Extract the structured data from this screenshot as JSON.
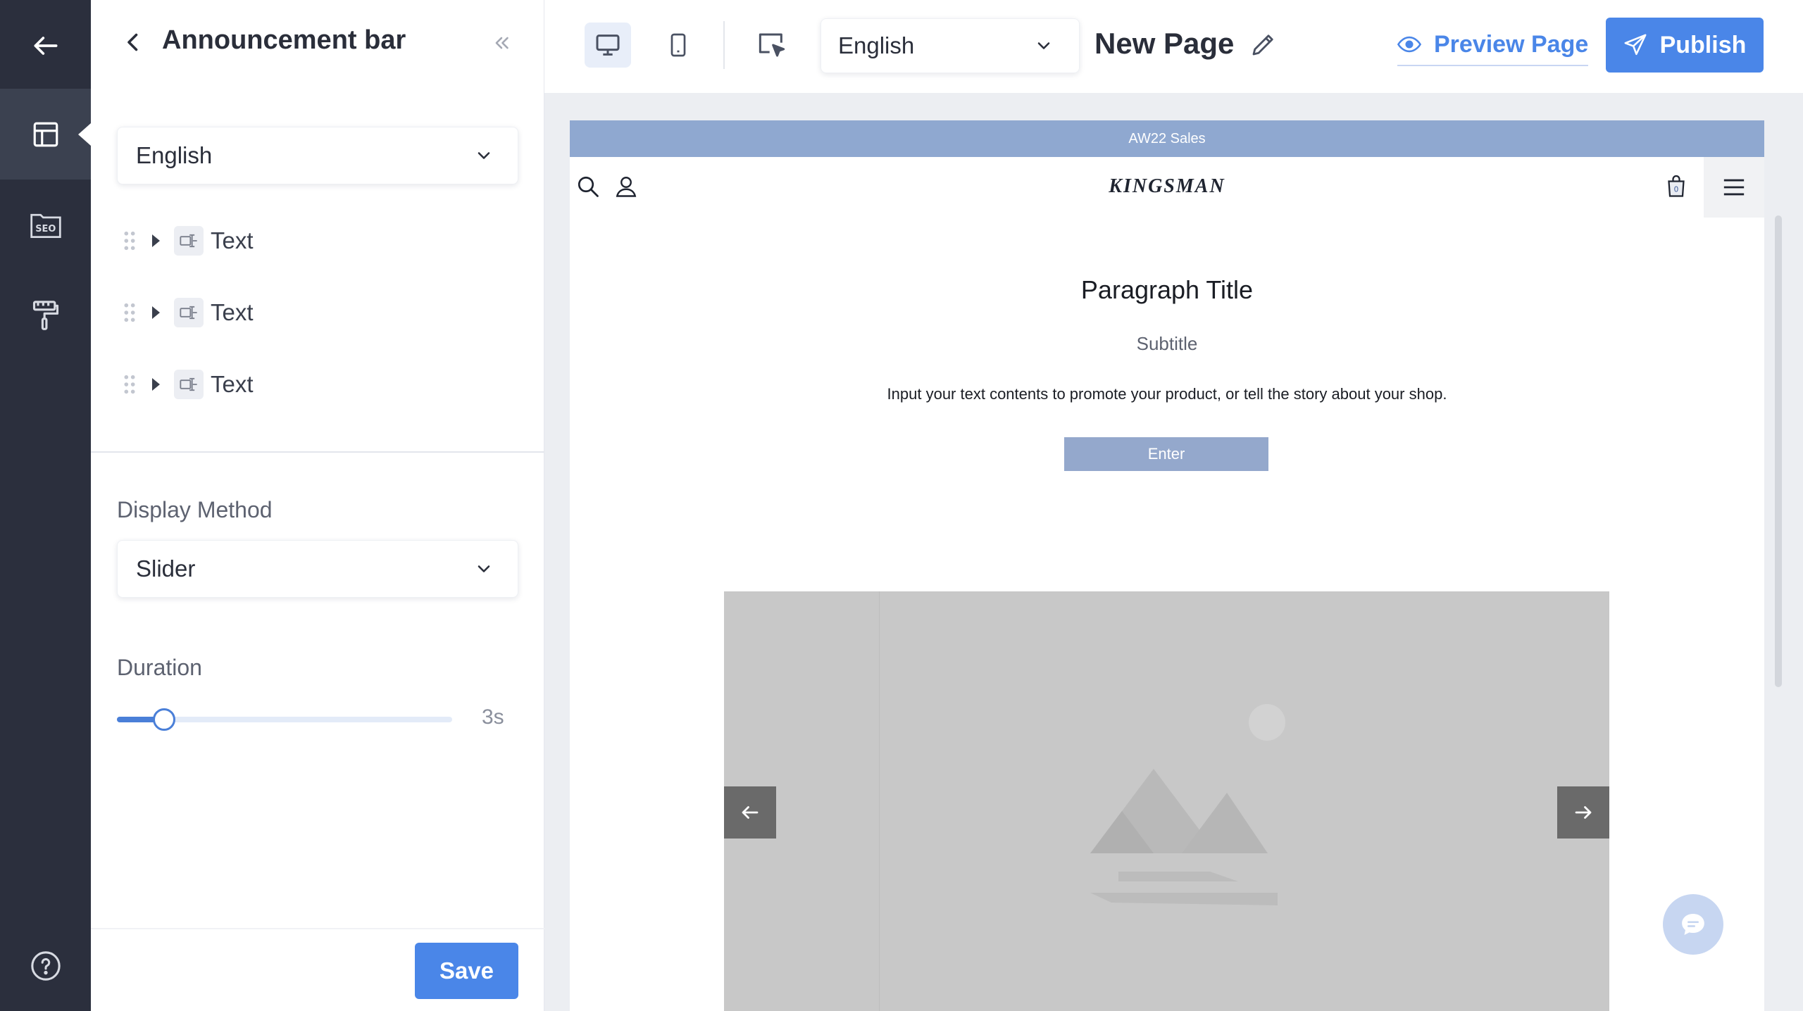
{
  "rail": {
    "items": [
      "back",
      "layout",
      "seo",
      "theme",
      "help"
    ]
  },
  "panel": {
    "title": "Announcement bar",
    "language": "English",
    "tree_items": [
      {
        "label": "Text"
      },
      {
        "label": "Text"
      },
      {
        "label": "Text"
      }
    ],
    "display_method_label": "Display Method",
    "display_method_value": "Slider",
    "duration_label": "Duration",
    "duration_value": "3s",
    "duration_level": 0.14,
    "save_label": "Save"
  },
  "toolbar": {
    "language": "English",
    "page_name": "New Page",
    "preview_label": "Preview Page",
    "publish_label": "Publish"
  },
  "preview": {
    "announcement": "AW22 Sales",
    "logo": "KINGSMAN",
    "cart_count": "0",
    "paragraph_title": "Paragraph Title",
    "subtitle": "Subtitle",
    "body": "Input your text contents to promote your product, or tell the story about your shop.",
    "enter_label": "Enter"
  },
  "colors": {
    "rail_bg": "#2b2f3d",
    "accent": "#4a86e8",
    "announcement_bg": "#8fa8d0"
  }
}
